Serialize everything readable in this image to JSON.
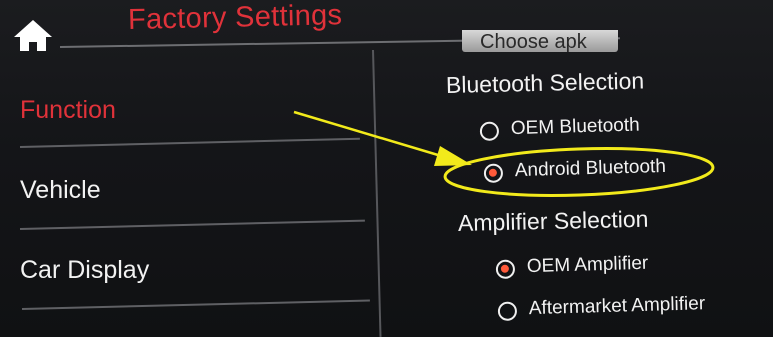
{
  "header": {
    "title": "Factory Settings",
    "home_icon": "home-icon"
  },
  "sidebar": {
    "items": [
      {
        "label": "Function",
        "active": true
      },
      {
        "label": "Vehicle",
        "active": false
      },
      {
        "label": "Car Display",
        "active": false
      }
    ]
  },
  "panel": {
    "choose_apk_label": "Choose apk",
    "bluetooth": {
      "heading": "Bluetooth Selection",
      "options": [
        {
          "label": "OEM Bluetooth",
          "selected": false
        },
        {
          "label": "Android Bluetooth",
          "selected": true
        }
      ]
    },
    "amplifier": {
      "heading": "Amplifier Selection",
      "options": [
        {
          "label": "OEM Amplifier",
          "selected": true
        },
        {
          "label": "Aftermarket Amplifier",
          "selected": false
        }
      ]
    }
  },
  "colors": {
    "accent_red": "#e0323a",
    "radio_selected": "#ff5a3a",
    "annotation_yellow": "#f2ea1b",
    "background": "#141518"
  }
}
